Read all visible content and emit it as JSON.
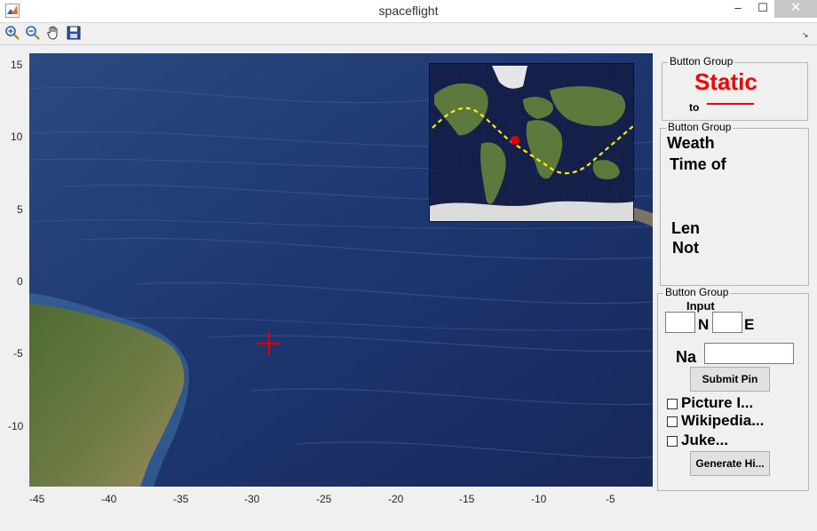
{
  "window": {
    "title": "spaceflight",
    "minimize": "‒",
    "maximize": "☐",
    "close": "✕"
  },
  "toolbar": {
    "tools": [
      "zoom-in-icon",
      "zoom-out-icon",
      "pan-hand-icon",
      "save-icon"
    ]
  },
  "axes": {
    "y_ticks": [
      "15",
      "10",
      "5",
      "0",
      "-5",
      "-10"
    ],
    "x_ticks": [
      "-45",
      "-40",
      "-35",
      "-30",
      "-25",
      "-20",
      "-15",
      "-10",
      "-5"
    ]
  },
  "panel_status": {
    "title": "Button Group",
    "static_text": "Static",
    "to_text": "to"
  },
  "panel_info": {
    "title": "Button Group",
    "line1": "Weath",
    "line2": "Time of",
    "line3": "Len",
    "line4": "Not"
  },
  "panel_input": {
    "title": "Button Group",
    "heading": "Input",
    "lat_suffix": "N",
    "lon_suffix": "E",
    "lat_value": "",
    "lon_value": "",
    "name_label": "Na",
    "name_value": "",
    "submit_label": "Submit Pin",
    "checkboxes": [
      {
        "label": "Picture I...",
        "checked": false
      },
      {
        "label": "Wikipedia...",
        "checked": false
      },
      {
        "label": "Juke...",
        "checked": false
      }
    ],
    "generate_label": "Generate Hi..."
  },
  "colors": {
    "marker": "#e00000",
    "track": "#ffee00",
    "static_text": "#ff0000",
    "ocean": "#1d3466"
  }
}
